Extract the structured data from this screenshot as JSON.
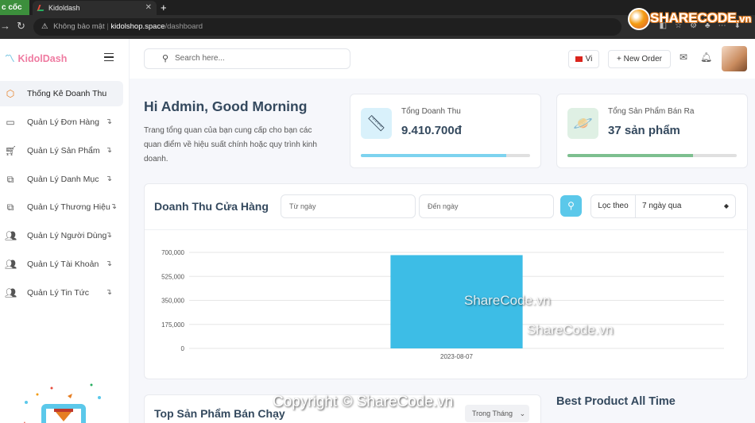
{
  "browser": {
    "coccoc_label": "c cốc",
    "tab_title": "Kidoldash",
    "security_label": "Không bảo mật",
    "url_host": "kidolshop.space",
    "url_path": "/dashboard"
  },
  "brand": {
    "logo_text": "KidolDash"
  },
  "sidebar": {
    "items": [
      {
        "label": "Thống Kê Doanh Thu",
        "icon": "box-icon",
        "active": true
      },
      {
        "label": "Quản Lý Đơn Hàng",
        "icon": "card-icon"
      },
      {
        "label": "Quản Lý Sản Phẩm",
        "icon": "cart-icon"
      },
      {
        "label": "Quản Lý Danh Mục",
        "icon": "copy-icon"
      },
      {
        "label": "Quản Lý Thương Hiệu",
        "icon": "copy-icon"
      },
      {
        "label": "Quản Lý Người Dùng",
        "icon": "users-icon"
      },
      {
        "label": "Quản Lý Tài Khoản",
        "icon": "users-icon"
      },
      {
        "label": "Quản Lý Tin Tức",
        "icon": "users-icon"
      }
    ]
  },
  "header": {
    "search_placeholder": "Search here...",
    "lang_label": "Vi",
    "new_order_label": "New Order"
  },
  "greeting": {
    "title": "Hi Admin, Good Morning",
    "text": "Trang tổng quan của bạn cung cấp cho bạn các quan điểm về hiệu suất chính hoặc quy trình kinh doanh."
  },
  "stats": [
    {
      "label": "Tổng Doanh Thu",
      "value": "9.410.700đ",
      "progress": 0.86,
      "color": "#7dd3ef"
    },
    {
      "label": "Tổng Sản Phẩm Bán Ra",
      "value": "37 sản phẩm",
      "progress": 0.74,
      "color": "#7dbf8f"
    }
  ],
  "revenue": {
    "title": "Doanh Thu Cửa Hàng",
    "from_placeholder": "Từ ngày",
    "to_placeholder": "Đến ngày",
    "filter_label": "Lọc theo",
    "filter_value": "7 ngày qua"
  },
  "chart_data": {
    "type": "bar",
    "categories": [
      "2023-08-07"
    ],
    "values": [
      680000
    ],
    "ylim": [
      0,
      700000
    ],
    "yticks": [
      "0",
      "175,000",
      "350,000",
      "525,000",
      "700,000"
    ],
    "color": "#3dbde6",
    "grid": true
  },
  "top_products": {
    "title": "Top Sản Phẩm Bán Chạy",
    "period_label": "Trong Tháng"
  },
  "best_product": {
    "title": "Best Product All Time"
  },
  "watermarks": {
    "center": "ShareCode.vn",
    "center2": "ShareCode.vn",
    "copyright": "Copyright © ShareCode.vn",
    "logo": "SHARECODE",
    "logo_suffix": ".vn"
  }
}
